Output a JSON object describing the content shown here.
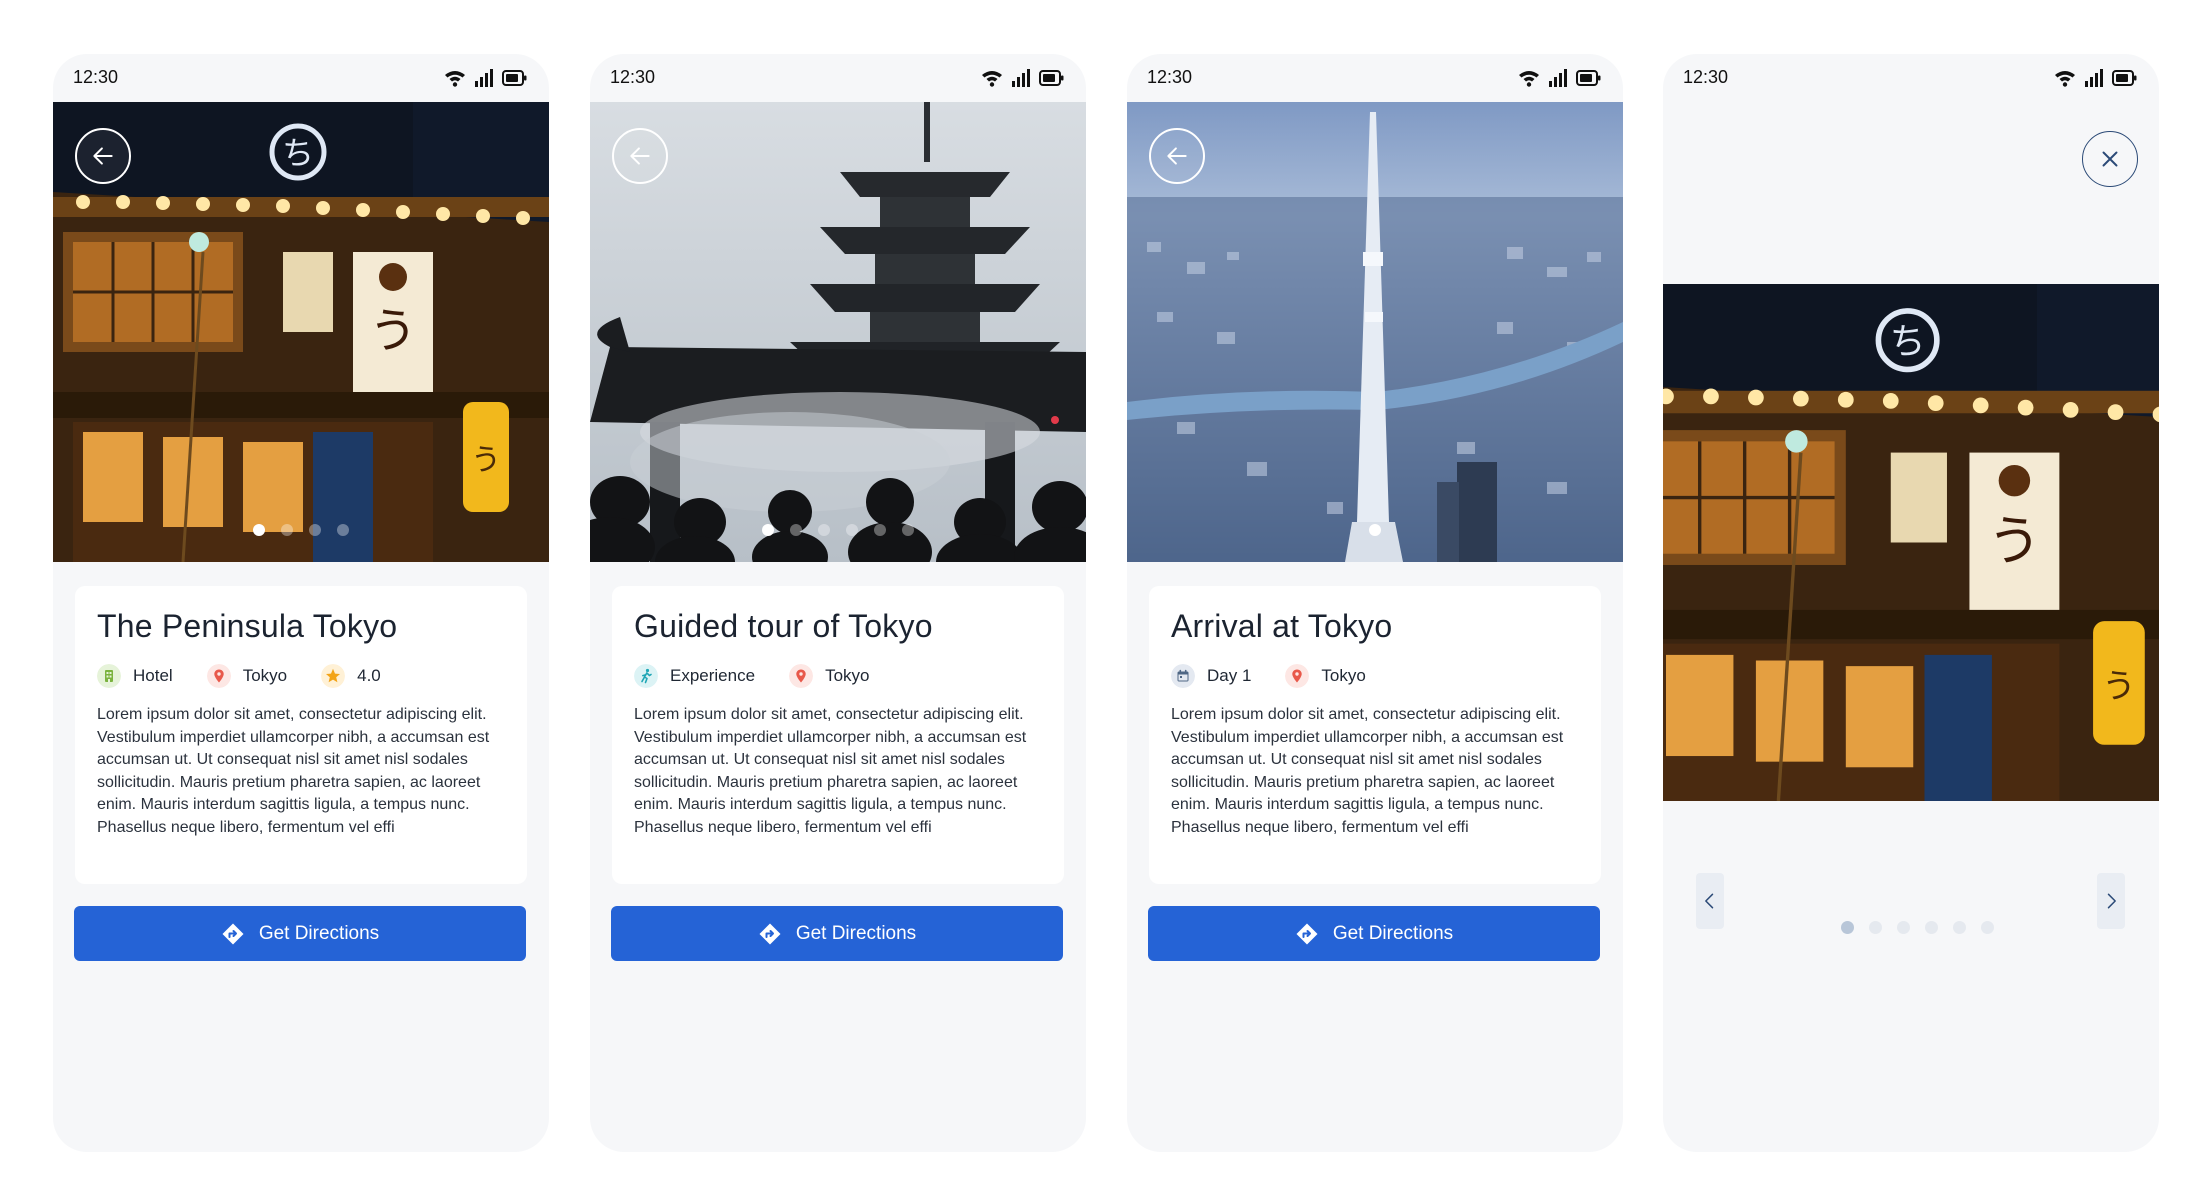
{
  "status_time": "12:30",
  "colors": {
    "primary": "#2563d6",
    "screen_bg": "#f6f7f9",
    "card_bg": "#ffffff"
  },
  "cta_label": "Get Directions",
  "screens": [
    {
      "title": "The Peninsula Tokyo",
      "tags": [
        {
          "icon": "hotel-icon",
          "label": "Hotel"
        },
        {
          "icon": "location-pin-icon",
          "label": "Tokyo"
        },
        {
          "icon": "star-icon",
          "label": "4.0"
        }
      ],
      "description": "Lorem ipsum dolor sit amet, consectetur adipiscing elit. Vestibulum imperdiet ullamcorper nibh, a accumsan est accumsan ut. Ut consequat nisl sit amet nisl sodales sollicitudin. Mauris pretium pharetra sapien, ac laoreet enim. Mauris interdum sagittis ligula, a tempus nunc. Phasellus neque libero, fermentum vel effi",
      "carousel": {
        "count": 4,
        "active": 1
      }
    },
    {
      "title": "Guided tour of Tokyo",
      "tags": [
        {
          "icon": "experience-icon",
          "label": "Experience"
        },
        {
          "icon": "location-pin-icon",
          "label": "Tokyo"
        }
      ],
      "description": "Lorem ipsum dolor sit amet, consectetur adipiscing elit. Vestibulum imperdiet ullamcorper nibh, a accumsan est accumsan ut. Ut consequat nisl sit amet nisl sodales sollicitudin. Mauris pretium pharetra sapien, ac laoreet enim. Mauris interdum sagittis ligula, a tempus nunc. Phasellus neque libero, fermentum vel effi",
      "carousel": {
        "count": 6,
        "active": 1
      }
    },
    {
      "title": "Arrival at Tokyo",
      "tags": [
        {
          "icon": "calendar-icon",
          "label": "Day 1"
        },
        {
          "icon": "location-pin-icon",
          "label": "Tokyo"
        }
      ],
      "description": "Lorem ipsum dolor sit amet, consectetur adipiscing elit. Vestibulum imperdiet ullamcorper nibh, a accumsan est accumsan ut. Ut consequat nisl sit amet nisl sodales sollicitudin. Mauris pretium pharetra sapien, ac laoreet enim. Mauris interdum sagittis ligula, a tempus nunc. Phasellus neque libero, fermentum vel effi",
      "carousel": {
        "count": 1,
        "active": 1
      }
    }
  ],
  "gallery": {
    "count": 6,
    "active": 1
  }
}
